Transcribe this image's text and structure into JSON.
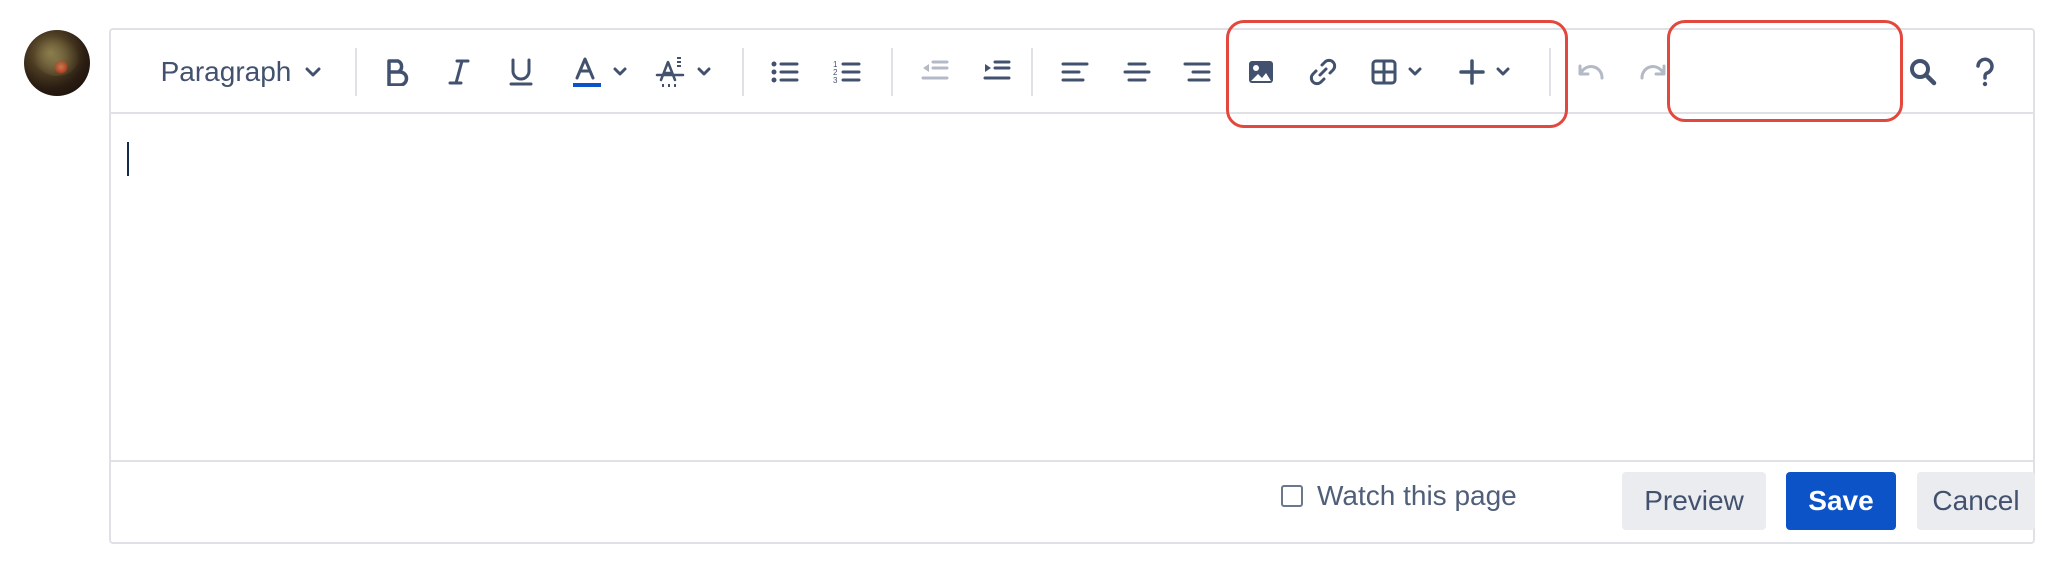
{
  "avatar": {
    "icon": "user-avatar"
  },
  "toolbar": {
    "paragraph_label": "Paragraph",
    "buttons": [
      {
        "icon": "bold-icon"
      },
      {
        "icon": "italic-icon"
      },
      {
        "icon": "underline-icon"
      },
      {
        "icon": "text-color-icon"
      },
      {
        "icon": "clear-formatting-icon"
      },
      {
        "icon": "bullet-list-icon"
      },
      {
        "icon": "numbered-list-icon"
      },
      {
        "icon": "outdent-icon"
      },
      {
        "icon": "indent-icon"
      },
      {
        "icon": "align-left-icon"
      },
      {
        "icon": "align-center-icon"
      },
      {
        "icon": "align-right-icon"
      },
      {
        "icon": "image-icon"
      },
      {
        "icon": "link-icon"
      },
      {
        "icon": "table-icon"
      },
      {
        "icon": "insert-plus-icon"
      },
      {
        "icon": "undo-icon"
      },
      {
        "icon": "redo-icon"
      },
      {
        "icon": "search-icon"
      },
      {
        "icon": "help-icon"
      }
    ]
  },
  "footer": {
    "watch_label": "Watch this page",
    "watch_checked": false,
    "preview_label": "Preview",
    "save_label": "Save",
    "cancel_label": "Cancel"
  },
  "colors": {
    "highlight": "#e2483d",
    "save_button": "#0c53c7",
    "text_color_underline": "#0c53c7"
  }
}
